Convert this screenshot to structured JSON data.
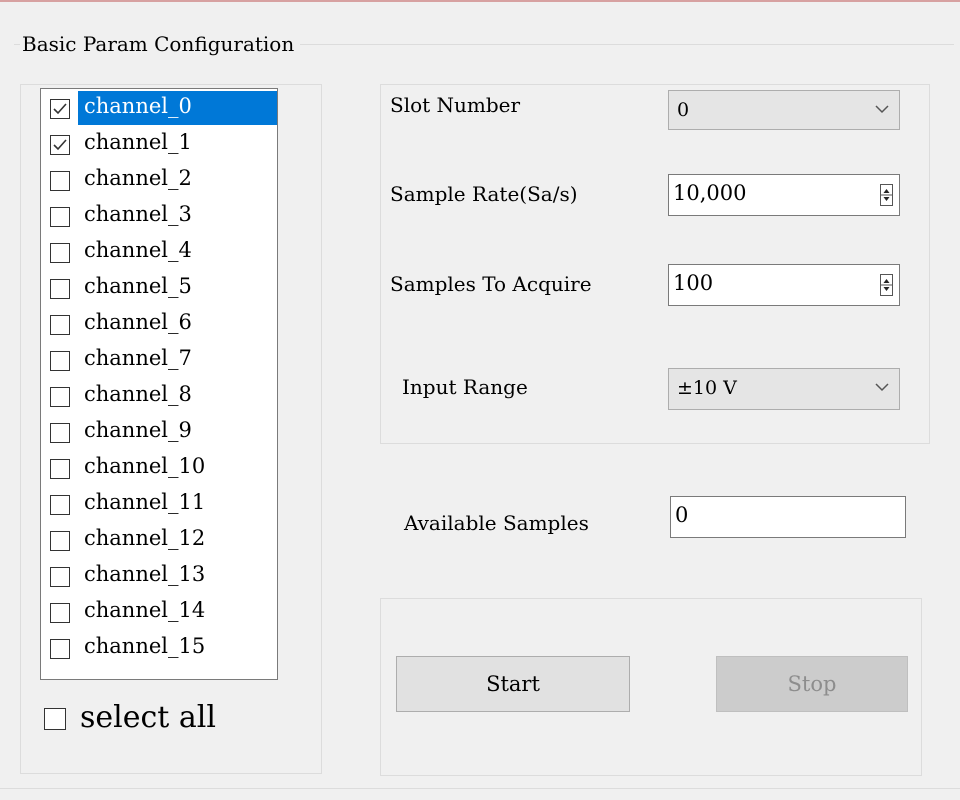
{
  "group": {
    "title": "Basic Param Configuration"
  },
  "channels": {
    "items": [
      {
        "label": "channel_0",
        "checked": true,
        "selected": true
      },
      {
        "label": "channel_1",
        "checked": true,
        "selected": false
      },
      {
        "label": "channel_2",
        "checked": false,
        "selected": false
      },
      {
        "label": "channel_3",
        "checked": false,
        "selected": false
      },
      {
        "label": "channel_4",
        "checked": false,
        "selected": false
      },
      {
        "label": "channel_5",
        "checked": false,
        "selected": false
      },
      {
        "label": "channel_6",
        "checked": false,
        "selected": false
      },
      {
        "label": "channel_7",
        "checked": false,
        "selected": false
      },
      {
        "label": "channel_8",
        "checked": false,
        "selected": false
      },
      {
        "label": "channel_9",
        "checked": false,
        "selected": false
      },
      {
        "label": "channel_10",
        "checked": false,
        "selected": false
      },
      {
        "label": "channel_11",
        "checked": false,
        "selected": false
      },
      {
        "label": "channel_12",
        "checked": false,
        "selected": false
      },
      {
        "label": "channel_13",
        "checked": false,
        "selected": false
      },
      {
        "label": "channel_14",
        "checked": false,
        "selected": false
      },
      {
        "label": "channel_15",
        "checked": false,
        "selected": false
      }
    ],
    "select_all": {
      "label": "select all",
      "checked": false
    }
  },
  "params": {
    "slot_number": {
      "label": "Slot Number",
      "value": "0"
    },
    "sample_rate": {
      "label": "Sample Rate(Sa/s)",
      "value": "10,000"
    },
    "samples_to_acquire": {
      "label": "Samples To Acquire",
      "value": "100"
    },
    "input_range": {
      "label": "Input Range",
      "value": "±10 V"
    }
  },
  "available": {
    "label": "Available Samples",
    "value": "0"
  },
  "buttons": {
    "start": {
      "label": "Start",
      "enabled": true
    },
    "stop": {
      "label": "Stop",
      "enabled": false
    }
  },
  "colors": {
    "selection": "#0078d7",
    "window_bg": "#f0f0f0",
    "disabled_text": "#8d8d8d"
  },
  "icons": {
    "check": "checkmark-icon",
    "dropdown": "chevron-down-icon",
    "spin": "spin-updown-icon"
  }
}
